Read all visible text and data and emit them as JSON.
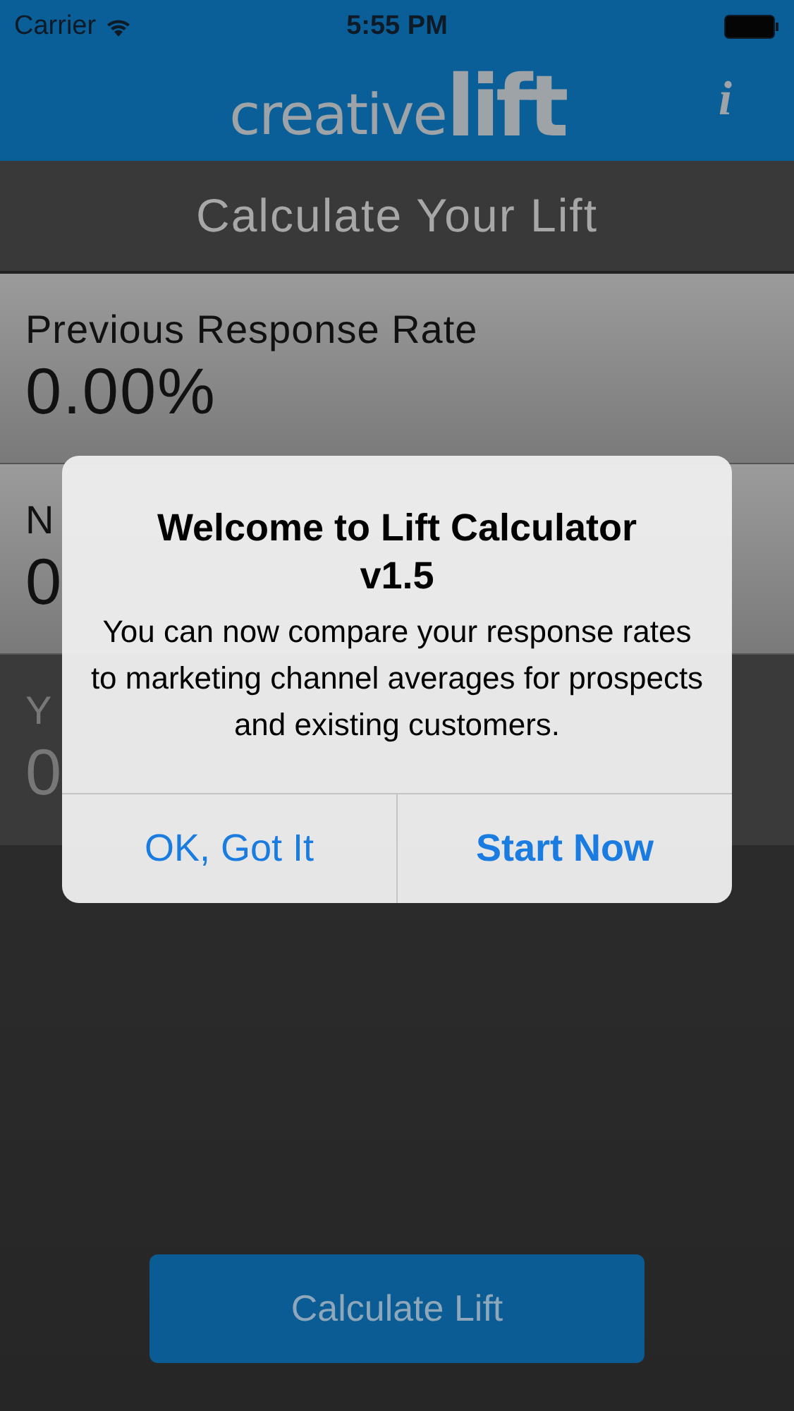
{
  "status_bar": {
    "carrier": "Carrier",
    "time": "5:55 PM"
  },
  "header": {
    "logo_light": "creative",
    "logo_bold": "lift",
    "info": "i"
  },
  "title": "Calculate Your Lift",
  "fields": [
    {
      "label": "Previous Response Rate",
      "value": "0.00%",
      "kind": "light"
    },
    {
      "label": "N",
      "value": "0",
      "kind": "light"
    },
    {
      "label": "Y",
      "value": "0",
      "kind": "dark"
    }
  ],
  "calculate_button": "Calculate Lift",
  "alert": {
    "title": "Welcome to Lift Calculator v1.5",
    "message": "You can now compare your response rates to marketing channel averages for prospects and existing customers.",
    "buttons": [
      {
        "label": "OK, Got It",
        "kind": "normal"
      },
      {
        "label": "Start Now",
        "kind": "bold"
      }
    ]
  }
}
